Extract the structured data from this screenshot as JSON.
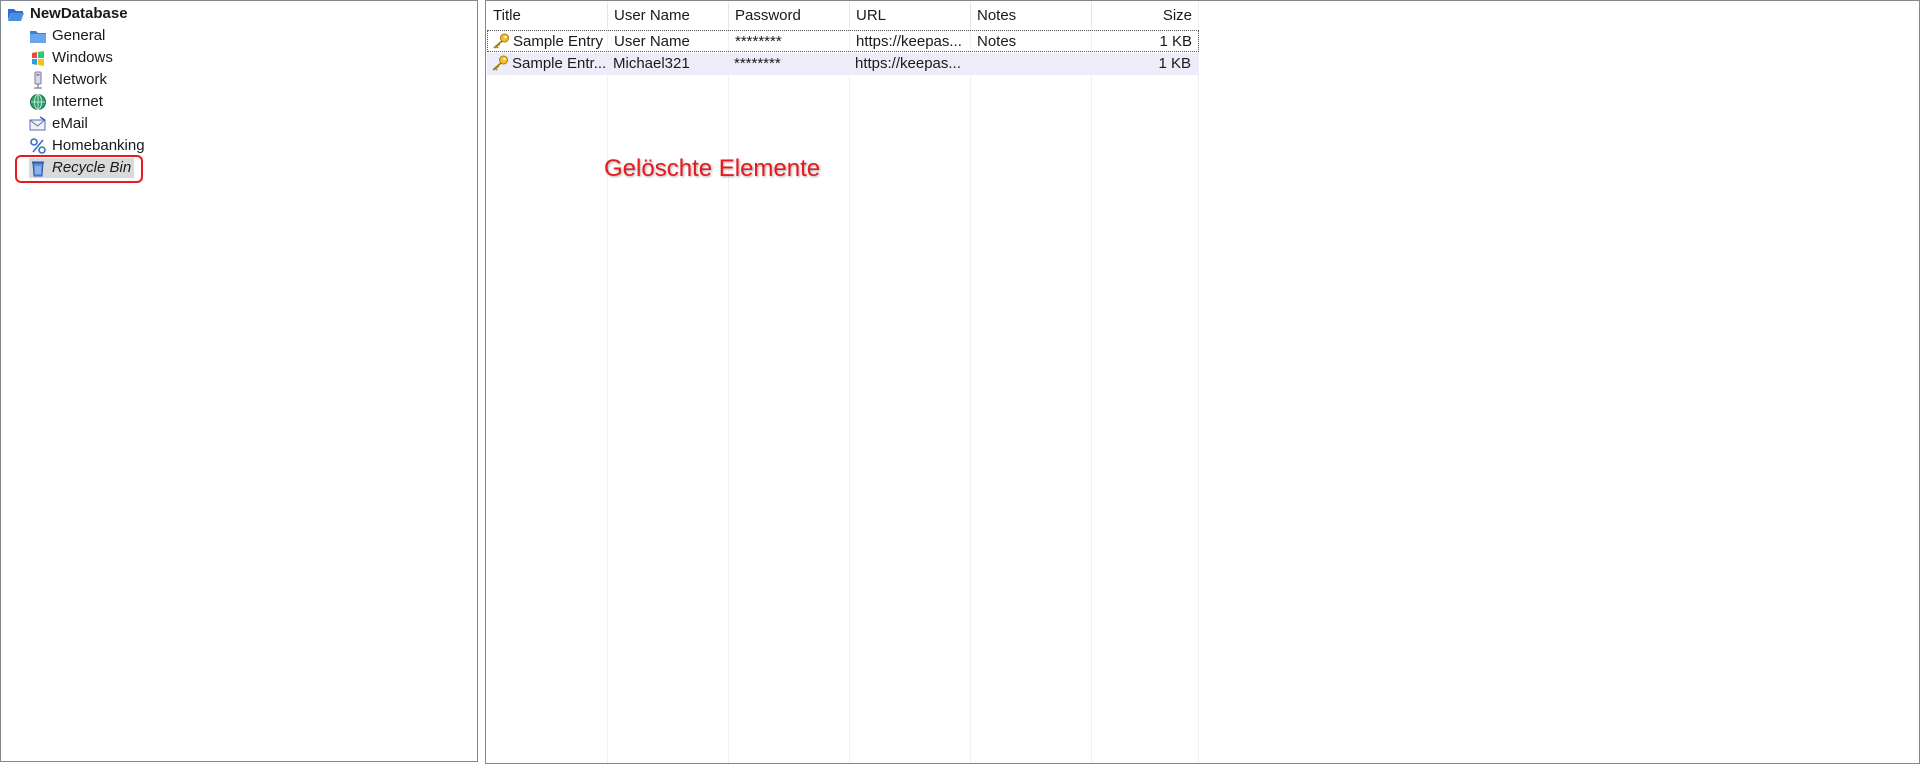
{
  "tree": {
    "root": {
      "label": "NewDatabase",
      "icon": "folder-open-icon"
    },
    "items": [
      {
        "label": "General",
        "icon": "folder-icon"
      },
      {
        "label": "Windows",
        "icon": "windows-icon"
      },
      {
        "label": "Network",
        "icon": "network-icon"
      },
      {
        "label": "Internet",
        "icon": "globe-icon"
      },
      {
        "label": "eMail",
        "icon": "email-icon"
      },
      {
        "label": "Homebanking",
        "icon": "percent-icon"
      },
      {
        "label": "Recycle Bin",
        "icon": "recycle-bin-icon",
        "selected": true
      }
    ]
  },
  "list": {
    "columns": [
      "Title",
      "User Name",
      "Password",
      "URL",
      "Notes",
      "Size"
    ],
    "rows": [
      {
        "icon": "key-icon",
        "title": "Sample Entry",
        "username": "User Name",
        "password": "********",
        "url": "https://keepas...",
        "notes": "Notes",
        "size": "1 KB"
      },
      {
        "icon": "key-icon",
        "title": "Sample Entr...",
        "username": "Michael321",
        "password": "********",
        "url": "https://keepas...",
        "notes": "",
        "size": "1 KB"
      }
    ]
  },
  "annotation": "Gelöschte Elemente",
  "colors": {
    "annotation": "#e8191f",
    "selected_row": "#ededfa"
  }
}
